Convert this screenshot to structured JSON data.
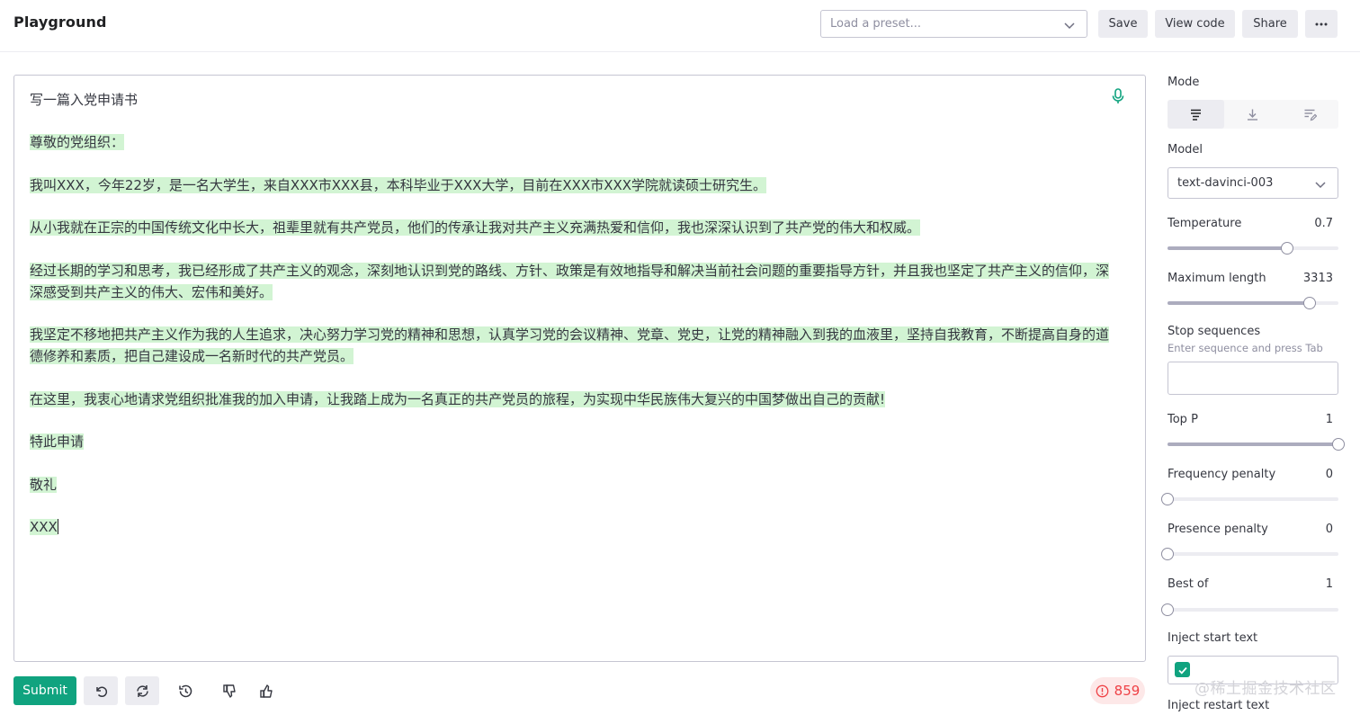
{
  "header": {
    "title": "Playground",
    "preset_placeholder": "Load a preset...",
    "save_label": "Save",
    "view_code_label": "View code",
    "share_label": "Share",
    "more_icon": "ellipsis-icon"
  },
  "editor": {
    "prompt": "写一篇入党申请书",
    "completion": [
      "尊敬的党组织：",
      "我叫XXX，今年22岁，是一名大学生，来自XXX市XXX县，本科毕业于XXX大学，目前在XXX市XXX学院就读硕士研究生。",
      "从小我就在正宗的中国传统文化中长大，祖辈里就有共产党员，他们的传承让我对共产主义充满热爱和信仰，我也深深认识到了共产党的伟大和权威。",
      "经过长期的学习和思考，我已经形成了共产主义的观念，深刻地认识到党的路线、方针、政策是有效地指导和解决当前社会问题的重要指导方针，并且我也坚定了共产主义的信仰，深深感受到共产主义的伟大、宏伟和美好。",
      "我坚定不移地把共产主义作为我的人生追求，决心努力学习党的精神和思想，认真学习党的会议精神、党章、党史，让党的精神融入到我的血液里，坚持自我教育，不断提高自身的道德修养和素质，把自己建设成一名新时代的共产党员。",
      "在这里，我衷心地请求党组织批准我的加入申请，让我踏上成为一名真正的共产党员的旅程，为实现中华民族伟大复兴的中国梦做出自己的贡献!",
      "特此申请",
      "敬礼",
      "XXX"
    ],
    "highlight_color": "#d2f4d3"
  },
  "footer": {
    "submit_label": "Submit",
    "token_count": "859"
  },
  "settings": {
    "mode_label": "Mode",
    "model_label": "Model",
    "model_value": "text-davinci-003",
    "temperature": {
      "label": "Temperature",
      "value": "0.7",
      "fraction": 0.7
    },
    "max_length": {
      "label": "Maximum length",
      "value": "3313",
      "fraction": 0.83
    },
    "stop_sequences": {
      "label": "Stop sequences",
      "hint": "Enter sequence and press Tab"
    },
    "top_p": {
      "label": "Top P",
      "value": "1",
      "fraction": 1.0
    },
    "frequency_penalty": {
      "label": "Frequency penalty",
      "value": "0",
      "fraction": 0
    },
    "presence_penalty": {
      "label": "Presence penalty",
      "value": "0",
      "fraction": 0
    },
    "best_of": {
      "label": "Best of",
      "value": "1",
      "fraction": 0
    },
    "inject_start": {
      "label": "Inject start text",
      "checked": true
    },
    "inject_restart": {
      "label": "Inject restart text"
    }
  },
  "watermark": "@稀土掘金技术社区",
  "colors": {
    "accent": "#10a37f",
    "danger": "#ef4146"
  }
}
